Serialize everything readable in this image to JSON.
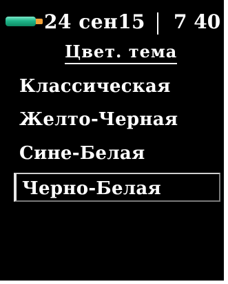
{
  "status_bar": {
    "battery_icon": "battery-icon",
    "date": "24 сен15",
    "time": "7 40"
  },
  "menu": {
    "title": "Цвет. тема",
    "items": [
      {
        "label": "Классическая",
        "selected": false
      },
      {
        "label": "Желто-Черная",
        "selected": false
      },
      {
        "label": "Сине-Белая",
        "selected": false
      },
      {
        "label": "Черно-Белая",
        "selected": true
      }
    ]
  },
  "colors": {
    "background": "#000000",
    "text": "#ffffff",
    "battery": "#1fb68a",
    "battery_tip": "#f2a23a"
  }
}
